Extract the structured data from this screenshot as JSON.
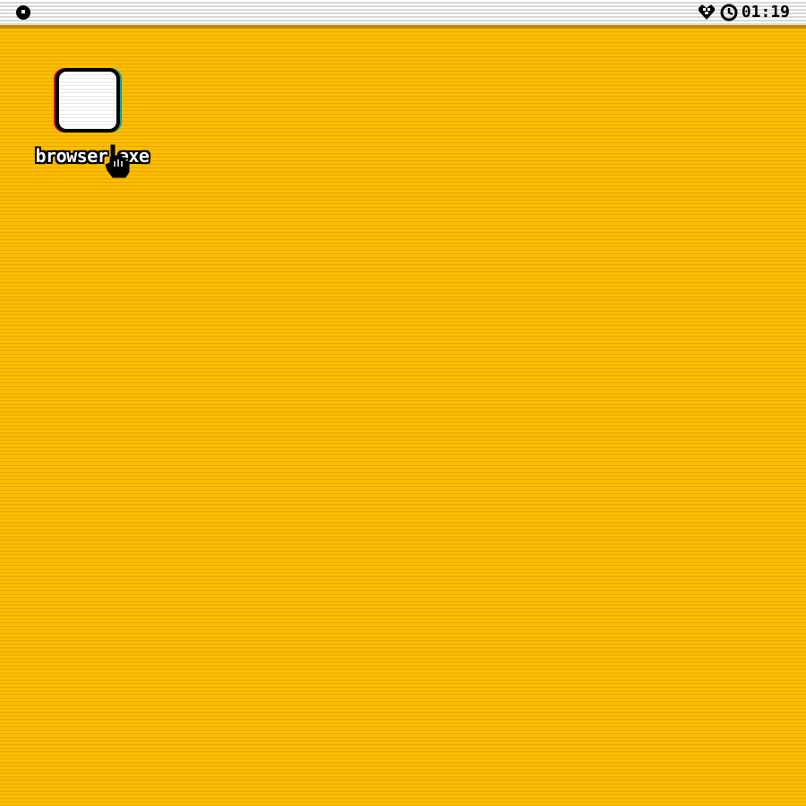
{
  "menubar": {
    "logo_icon": "os-logo-icon",
    "tray": {
      "network_icon": "heart-network-icon",
      "clock_icon": "clock-icon",
      "time": "01:19"
    }
  },
  "desktop": {
    "background_color": "#fcbd00",
    "icons": [
      {
        "label": "browser.exe",
        "icon": "blank-window-icon"
      }
    ]
  },
  "cursor": {
    "type": "hand-pointer-icon"
  }
}
